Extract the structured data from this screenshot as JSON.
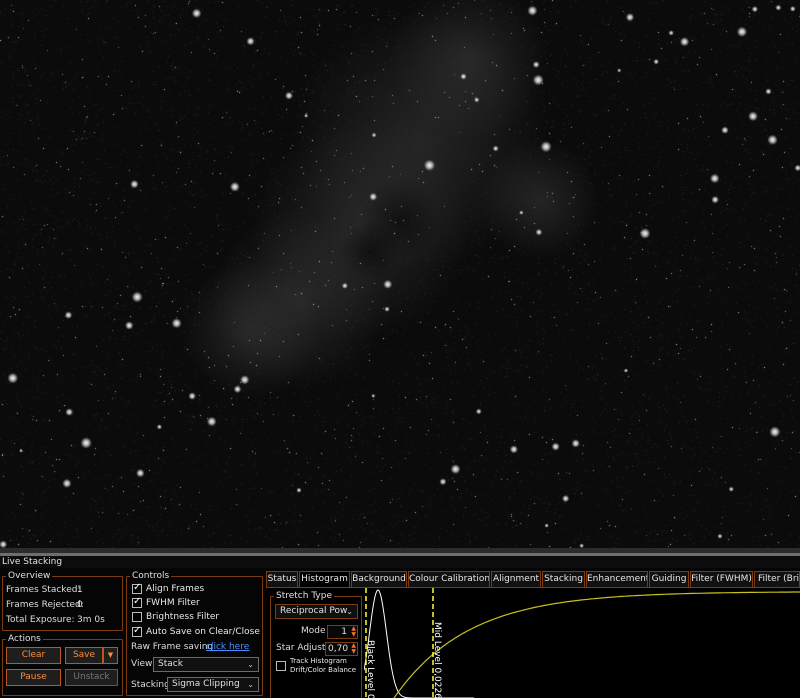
{
  "image": {
    "subject": "Heart nebula Ha live stack"
  },
  "panel": {
    "title": "Live Stacking"
  },
  "overview": {
    "legend": "Overview",
    "frames_stacked_label": "Frames Stacked:",
    "frames_stacked_value": "1",
    "frames_rejected_label": "Frames Rejected:",
    "frames_rejected_value": "0",
    "total_exposure_label": "Total Exposure:",
    "total_exposure_value": "3m 0s"
  },
  "actions": {
    "legend": "Actions",
    "clear": "Clear",
    "save": "Save",
    "pause": "Pause",
    "unstack": "Unstack",
    "dropdown_glyph": "▼"
  },
  "controls": {
    "legend": "Controls",
    "align_frames": "Align Frames",
    "fwhm_filter": "FWHM Filter",
    "brightness_filter": "Brightness Filter",
    "auto_save": "Auto Save on Clear/Close",
    "raw_frame_label": "Raw Frame saving",
    "raw_frame_link": "click here",
    "view_label": "View",
    "view_value": "Stack",
    "stacking_label": "Stacking",
    "stacking_value": "Sigma Clipping",
    "arrow": "⌄"
  },
  "tabs": [
    {
      "label": "Status"
    },
    {
      "label": "Histogram"
    },
    {
      "label": "Background"
    },
    {
      "label": "Colour Calibration"
    },
    {
      "label": "Alignment"
    },
    {
      "label": "Stacking"
    },
    {
      "label": "Enhancement"
    },
    {
      "label": "Guiding"
    },
    {
      "label": "Filter (FWHM)"
    },
    {
      "label": "Filter (Brig"
    }
  ],
  "stretch": {
    "legend": "Stretch Type",
    "type_value": "Reciprocal Pow",
    "mode_label": "Mode",
    "mode_value": "1",
    "star_adjust_label": "Star Adjust",
    "star_adjust_value": "0,70",
    "track_label_1": "Track Histogram",
    "track_label_2": "Drift/Color Balance",
    "spin_up": "▲",
    "spin_down": "▼"
  },
  "histogram": {
    "black_level_label": "Black Level 0",
    "mid_level_label": "Mid Level 0,0226",
    "colors": {
      "line": "#ffff30",
      "curve": "#c8c020",
      "hist": "#ffffff"
    }
  }
}
